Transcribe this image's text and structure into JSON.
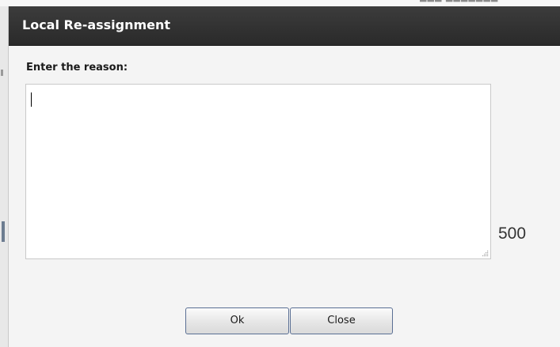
{
  "dialog": {
    "title": "Local Re-assignment",
    "prompt_label": "Enter the reason:",
    "reason_value": "",
    "char_counter": "500",
    "ok_label": "Ok",
    "close_label": "Close"
  },
  "colors": {
    "titlebar": "#333333",
    "title_text": "#ffffff",
    "dialog_bg": "#f4f4f4",
    "button_border": "#5a6f94"
  },
  "icons": {
    "resize_grip": "resize-grip-icon"
  }
}
